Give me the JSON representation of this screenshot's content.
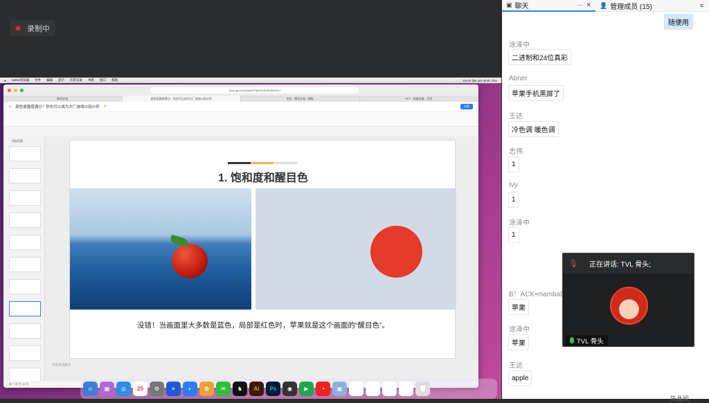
{
  "recording": {
    "label": "录制中"
  },
  "mac_menubar": {
    "items": [
      "Safari浏览器",
      "文件",
      "编辑",
      "显示",
      "历史记录",
      "书签",
      "窗口",
      "帮助"
    ],
    "now_playing": "You're like just what I like"
  },
  "browser": {
    "url": "docs.qq.com/slide/DTlpHVEZkZEtWVmFY",
    "tabs": [
      "腾讯文档",
      "颜色氛围感满分！你也可以成为大厂游戏UI设计师",
      "首页 - 腾讯文档 - 模板",
      "PPT - 高级优美 - 百搭"
    ]
  },
  "doc": {
    "title": "颜色氛围感满分！你也可以成为大厂游戏UI设计师",
    "share_label": "分享",
    "add_slide": "添加页面",
    "notes_placeholder": "点击添加备注",
    "status": "第 7 页 共 48 页"
  },
  "slide": {
    "title": "1. 饱和度和醒目色",
    "caption": "没错！当画面里大多数是蓝色，局部是红色时，苹果就是这个画面的“醒目色”。"
  },
  "dock": {
    "calendar_day": "25",
    "apps": [
      "Ai",
      "Ps"
    ]
  },
  "chat": {
    "tab_chat": "聊天",
    "tab_members": "管理成员 (15)",
    "my_message": "随便用",
    "messages": [
      {
        "name": "涂泽中",
        "text": "二进制和24位真彩"
      },
      {
        "name": "Abner",
        "text": "苹果手机黑屏了"
      },
      {
        "name": "王达",
        "text": "冷色调 暖色调"
      },
      {
        "name": "志伟",
        "text": "1"
      },
      {
        "name": "Ivy",
        "text": "1"
      },
      {
        "name": "涂泽中",
        "text": "1"
      },
      {
        "name": "B！ACK•mambaD",
        "text": "苹果"
      },
      {
        "name": "涂泽中",
        "text": "苹果"
      },
      {
        "name": "王达",
        "text": "apple"
      }
    ],
    "footer": "陈晶妮"
  },
  "speaker": {
    "talking": "正在讲话: TVL 骨头;",
    "name": "TVL 骨头"
  }
}
